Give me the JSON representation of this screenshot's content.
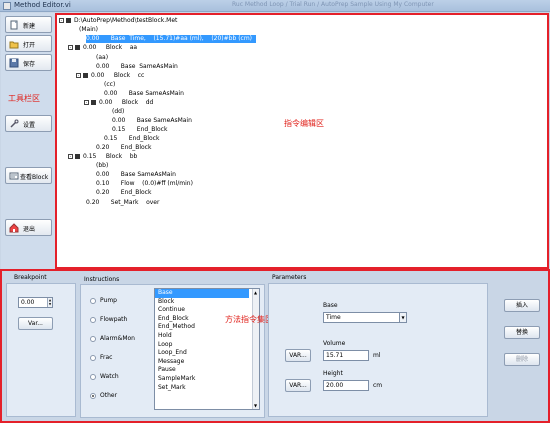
{
  "window": {
    "title": "Method Editor.vi",
    "ghost_title": "Ruc Method Loop / Trial Run / AutoPrep Sample Using My Computer"
  },
  "toolbar": {
    "new": "新建",
    "open": "打开",
    "save": "保存",
    "settings": "设置",
    "view_block": "查看Block",
    "exit": "退出",
    "annotation": "工具栏区"
  },
  "editor": {
    "annotation": "指令编辑区",
    "rows": [
      "D:\\AutoPrep\\Method\\testBlock.Met",
      "(Main)",
      "0.00      Base  Time,    (15.71)#aa (ml),    (20)#bb (cm)",
      "0.00     Block    aa",
      "(aa)",
      "0.00      Base  SameAsMain",
      "0.00     Block    cc",
      "(cc)",
      "0.00      Base SameAsMain",
      "0.00     Block    dd",
      "(dd)",
      "0.00      Base SameAsMain",
      "0.15      End_Block",
      "0.15      End_Block",
      "0.20      End_Block",
      "0.15     Block    bb",
      "(bb)",
      "0.00      Base SameAsMain",
      "0.10      Flow    (0.0)#ff (ml/min)",
      "0.20      End_Block",
      "0.20      Set_Mark    over"
    ]
  },
  "breakpoint": {
    "label": "Breakpoint",
    "value": "0.00",
    "var_button": "Var..."
  },
  "instructions": {
    "label": "Instructions",
    "categories": [
      "Pump",
      "Flowpath",
      "Alarm&Mon",
      "Frac",
      "Watch",
      "Other"
    ],
    "selected_category": "Other",
    "items": [
      "Base",
      "Block",
      "Continue",
      "End_Block",
      "End_Method",
      "Hold",
      "Loop",
      "Loop_End",
      "Message",
      "Pause",
      "SampleMark",
      "Set_Mark"
    ],
    "selected_item": "Base",
    "annotation": "方法指令集区域"
  },
  "parameters": {
    "label": "Parameters",
    "base_label": "Base",
    "base_value": "Time",
    "volume_label": "Volume",
    "volume_value": "15.71",
    "volume_unit": "ml",
    "height_label": "Height",
    "height_value": "20.00",
    "height_unit": "cm",
    "var_button": "VAR..."
  },
  "actions": {
    "insert": "插入",
    "replace": "替换",
    "delete": "删除"
  }
}
